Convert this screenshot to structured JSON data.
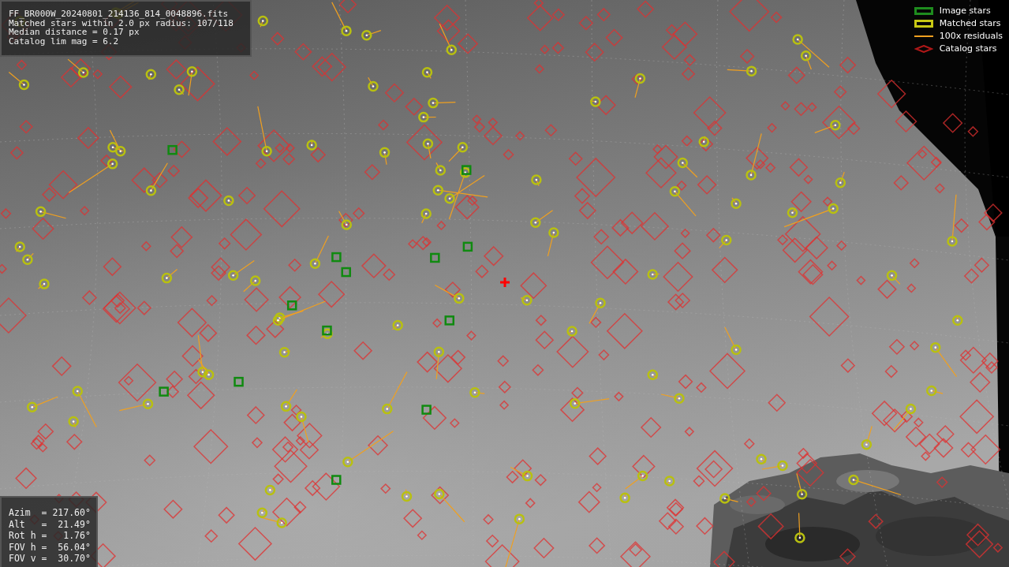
{
  "info_box": {
    "lines": [
      "FF_BR000W_20240801_214136_814_0048896.fits",
      "Matched stars within 2.0 px radius: 107/118",
      "Median distance = 0.17 px",
      "Catalog lim mag = 6.2"
    ]
  },
  "legend": [
    {
      "kind": "box",
      "label": "Image stars",
      "color": "#1e8c1e"
    },
    {
      "kind": "box",
      "label": "Matched stars",
      "color": "#c8c814"
    },
    {
      "kind": "line",
      "label": "100x residuals",
      "color": "#f0a020"
    },
    {
      "kind": "diamond",
      "label": "Catalog stars",
      "color": "#b01818"
    }
  ],
  "pointing_box": {
    "lines": [
      "Azim  = 217.60°",
      "Alt   =  21.49°",
      "Rot h =   1.76°",
      "FOV h =  56.04°",
      "FOV v =  30.70°"
    ]
  }
}
